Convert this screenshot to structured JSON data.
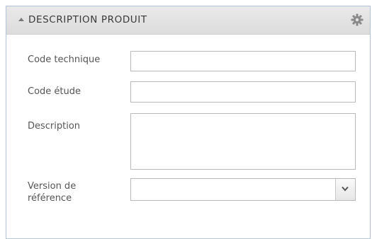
{
  "panel": {
    "title": "DESCRIPTION PRODUIT",
    "collapse_icon": "chevron-up-icon",
    "settings_icon": "gear-icon"
  },
  "form": {
    "code_technique": {
      "label": "Code technique",
      "value": ""
    },
    "code_etude": {
      "label": "Code étude",
      "value": ""
    },
    "description": {
      "label": "Description",
      "value": ""
    },
    "version_reference": {
      "label_line1": "Version de",
      "label_line2": "référence",
      "selected": ""
    }
  },
  "colors": {
    "header_bg": "#e2e2e2",
    "panel_border": "#b4c2d6",
    "field_border": "#b9b9b9",
    "label_text": "#555555"
  }
}
